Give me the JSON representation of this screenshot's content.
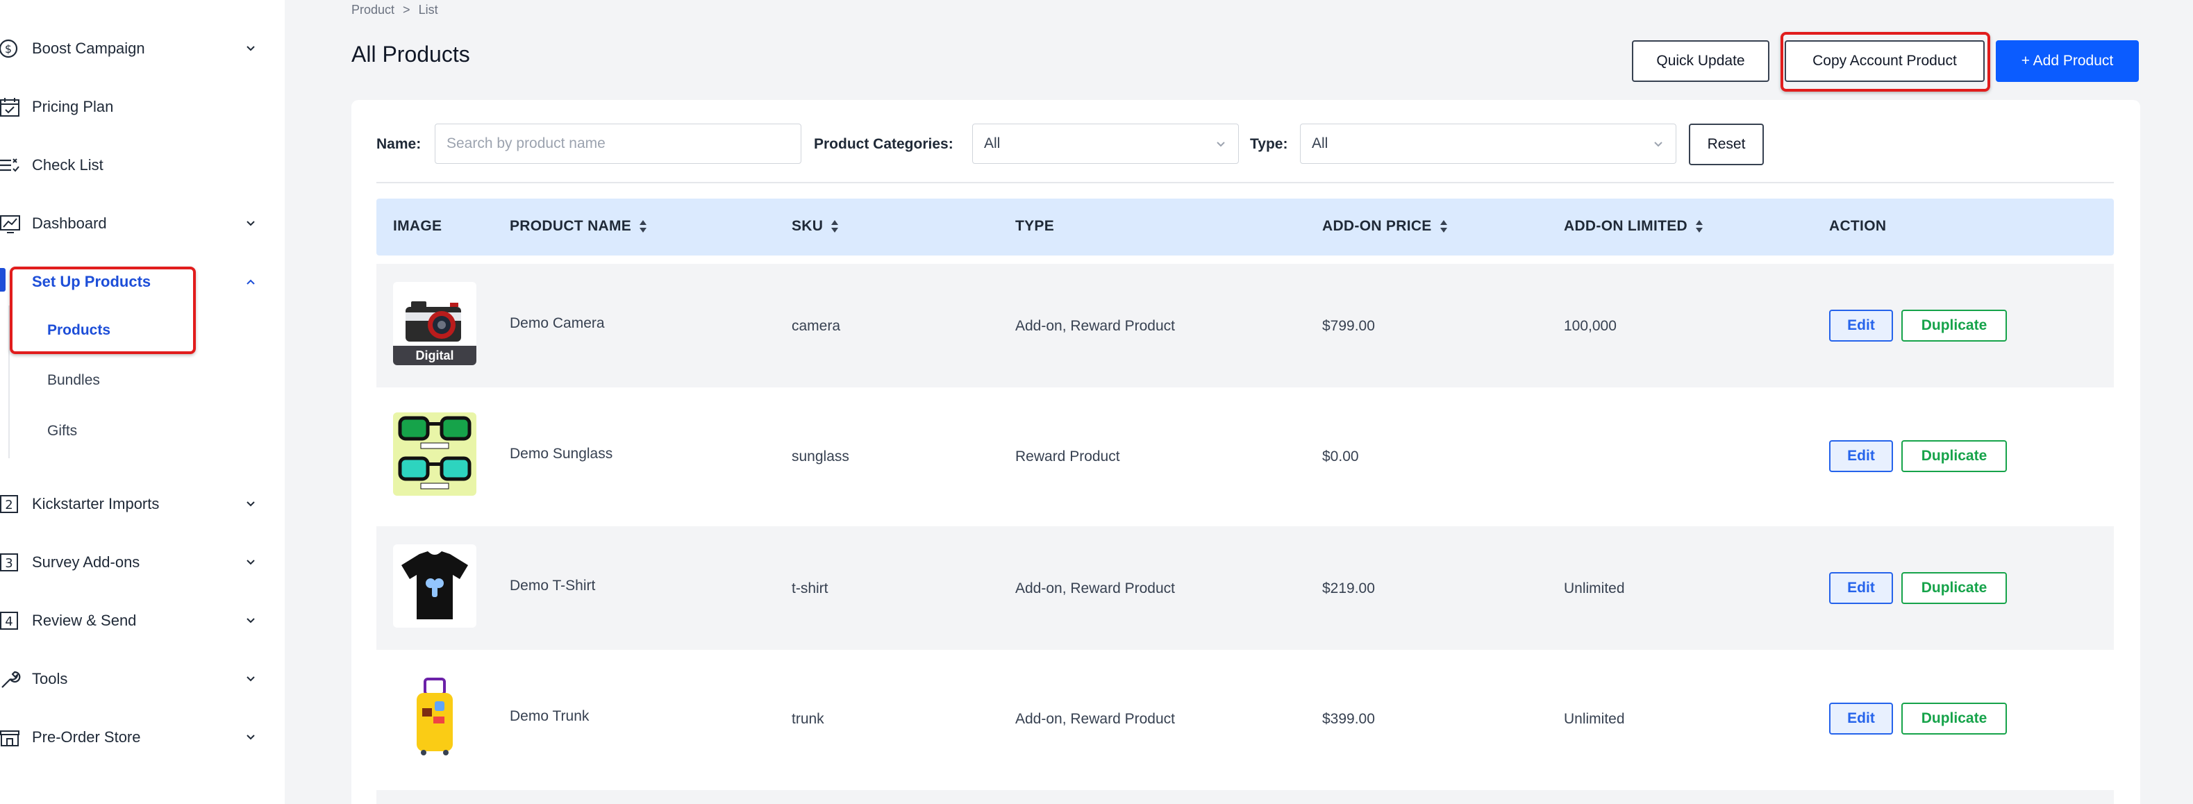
{
  "sidebar": {
    "items": [
      {
        "label": "Boost Campaign",
        "icon": "dollar-circle-icon",
        "has_chevron": true
      },
      {
        "label": "Pricing Plan",
        "icon": "calendar-check-icon",
        "has_chevron": false
      },
      {
        "label": "Check List",
        "icon": "checklist-icon",
        "has_chevron": false
      },
      {
        "label": "Dashboard",
        "icon": "dashboard-chart-icon",
        "has_chevron": true
      },
      {
        "label": "Set Up Products",
        "icon": "box-icon",
        "has_chevron": true,
        "active": true
      },
      {
        "label": "Kickstarter Imports",
        "icon": "step-2-icon",
        "icon_text": "2",
        "has_chevron": true
      },
      {
        "label": "Survey Add-ons",
        "icon": "step-3-icon",
        "icon_text": "3",
        "has_chevron": true
      },
      {
        "label": "Review & Send",
        "icon": "step-4-icon",
        "icon_text": "4",
        "has_chevron": true
      },
      {
        "label": "Tools",
        "icon": "wrench-icon",
        "has_chevron": true
      },
      {
        "label": "Pre-Order Store",
        "icon": "store-icon",
        "has_chevron": true
      }
    ],
    "sub_items": [
      {
        "label": "Products",
        "active": true
      },
      {
        "label": "Bundles"
      },
      {
        "label": "Gifts"
      }
    ]
  },
  "breadcrumb": {
    "parent": "Product",
    "separator": ">",
    "current": "List"
  },
  "page": {
    "title": "All Products"
  },
  "header_buttons": {
    "quick_update": "Quick Update",
    "copy_account": "Copy Account Product",
    "add_product": "+ Add Product"
  },
  "filters": {
    "name_label": "Name:",
    "name_placeholder": "Search by product name",
    "categories_label": "Product Categories:",
    "categories_value": "All",
    "type_label": "Type:",
    "type_value": "All",
    "reset_label": "Reset"
  },
  "table": {
    "columns": [
      "IMAGE",
      "PRODUCT NAME",
      "SKU",
      "TYPE",
      "ADD-ON PRICE",
      "ADD-ON LIMITED",
      "ACTION"
    ],
    "rows": [
      {
        "name": "Demo Camera",
        "sku": "camera",
        "type": "Add-on, Reward Product",
        "price": "$799.00",
        "limited": "100,000",
        "badge": "Digital",
        "image": "camera-image"
      },
      {
        "name": "Demo Sunglass",
        "sku": "sunglass",
        "type": "Reward Product",
        "price": "$0.00",
        "limited": "",
        "image": "sunglass-image"
      },
      {
        "name": "Demo T-Shirt",
        "sku": "t-shirt",
        "type": "Add-on, Reward Product",
        "price": "$219.00",
        "limited": "Unlimited",
        "image": "tshirt-image"
      },
      {
        "name": "Demo Trunk",
        "sku": "trunk",
        "type": "Add-on, Reward Product",
        "price": "$399.00",
        "limited": "Unlimited",
        "image": "trunk-image"
      }
    ],
    "edit_label": "Edit",
    "duplicate_label": "Duplicate"
  },
  "colors": {
    "primary": "#0b5cff",
    "highlight": "#e11d1d",
    "active_nav": "#1d4ed8",
    "header_bg": "#dbeafe",
    "success": "#16a34a"
  }
}
